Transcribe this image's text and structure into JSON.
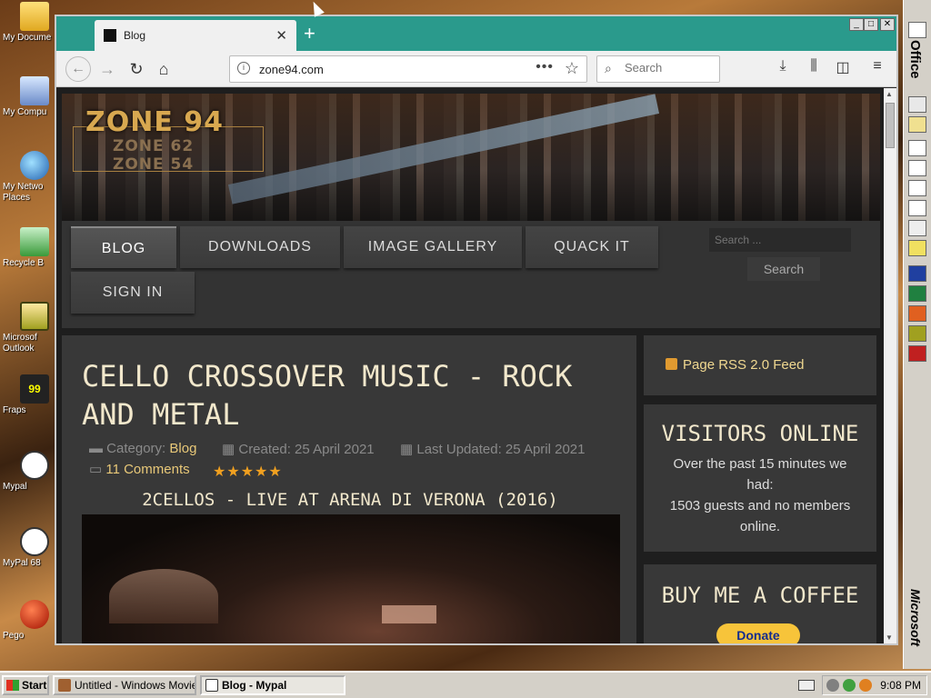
{
  "desktop": {
    "icons": [
      {
        "label": "My Docume",
        "icon": "folder-icon"
      },
      {
        "label": "My Compu",
        "icon": "computer-icon"
      },
      {
        "label": "My Netwo\nPlaces",
        "icon": "network-icon"
      },
      {
        "label": "Recycle B",
        "icon": "recycle-bin-icon"
      },
      {
        "label": "Microsof\nOutlook",
        "icon": "outlook-icon"
      },
      {
        "label": "Fraps",
        "icon": "fraps-icon"
      },
      {
        "label": "Mypal",
        "icon": "mypal-icon"
      },
      {
        "label": "MyPal 68",
        "icon": "mypal-icon"
      },
      {
        "label": "Pego",
        "icon": "pego-icon"
      }
    ]
  },
  "browser": {
    "tab_title": "Blog",
    "tab_close": "✕",
    "new_tab": "+",
    "window_controls": {
      "minimize": "_",
      "maximize": "□",
      "close": "✕"
    },
    "url": "zone94.com",
    "url_actions": "•••",
    "search_placeholder": "Search"
  },
  "site": {
    "logo": "ZONE 94",
    "logo_sub1": "ZONE 62",
    "logo_sub2": "ZONE 54",
    "menu": [
      {
        "label": "BLOG",
        "active": true
      },
      {
        "label": "DOWNLOADS"
      },
      {
        "label": "IMAGE GALLERY"
      },
      {
        "label": "QUACK IT"
      },
      {
        "label": "SIGN IN"
      }
    ],
    "search_placeholder": "Search ...",
    "search_button": "Search",
    "article": {
      "title": "CELLO CROSSOVER MUSIC - ROCK AND METAL",
      "category_label": "Category:",
      "category": "Blog",
      "created": "Created: 25 April 2021",
      "updated": "Last Updated: 25 April 2021",
      "comments": "11 Comments",
      "rating": "★★★★★",
      "video_title": "2CELLOS - LIVE AT ARENA DI VERONA (2016)"
    },
    "sidebar": {
      "rss": "Page RSS 2.0 Feed",
      "visitors_title": "VISITORS ONLINE",
      "visitors_text1": "Over the past 15 minutes we had:",
      "visitors_text2": "1503 guests and no members online.",
      "coffee_title": "BUY ME A COFFEE",
      "donate": "Donate"
    }
  },
  "officebar": {
    "title": "Office",
    "brand": "Microsoft"
  },
  "taskbar": {
    "start": "Start",
    "tasks": [
      {
        "label": "Untitled - Windows Movie...",
        "active": false
      },
      {
        "label": "Blog - Mypal",
        "active": true
      }
    ],
    "clock": "9:08 PM"
  }
}
